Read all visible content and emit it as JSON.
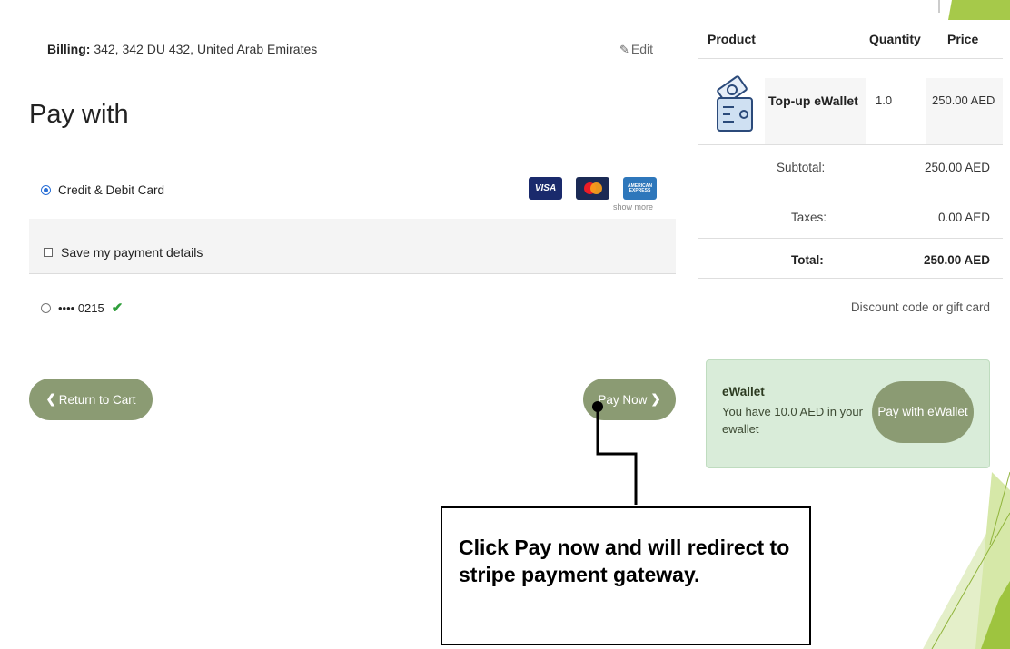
{
  "billing": {
    "label": "Billing:",
    "address": "342, 342 DU 432, United Arab Emirates",
    "edit_label": "Edit",
    "edit_icon": "edit-icon"
  },
  "payment": {
    "heading": "Pay with",
    "method_label": "Credit & Debit Card",
    "method_selected": true,
    "card_logos": [
      "VISA",
      "Mastercard",
      "American Express"
    ],
    "show_more_label": "show more",
    "save_details_label": "Save my payment details",
    "saved_card_label": "•••• 0215"
  },
  "buttons": {
    "return_label": "Return to Cart",
    "pay_now_label": "Pay Now",
    "pay_ewallet_label": "Pay with eWallet"
  },
  "order": {
    "columns": [
      "Product",
      "Quantity",
      "Price"
    ],
    "items": [
      {
        "name": "Top-up eWallet",
        "quantity": "1.0",
        "price": "250.00 AED"
      }
    ],
    "subtotal_label": "Subtotal:",
    "subtotal_value": "250.00 AED",
    "taxes_label": "Taxes:",
    "taxes_value": "0.00 AED",
    "total_label": "Total:",
    "total_value": "250.00 AED",
    "discount_label": "Discount code or gift card"
  },
  "ewallet": {
    "title": "eWallet",
    "balance_text": "You have 10.0 AED in your ewallet"
  },
  "annotation": {
    "text": "Click Pay now and will redirect to stripe payment gateway."
  },
  "colors": {
    "button": "#8b9b73",
    "ewallet_bg": "#d9ecd9",
    "accent_green": "#a6c94a",
    "radio_blue": "#2a6fd6",
    "check_green": "#2e9e3a"
  }
}
